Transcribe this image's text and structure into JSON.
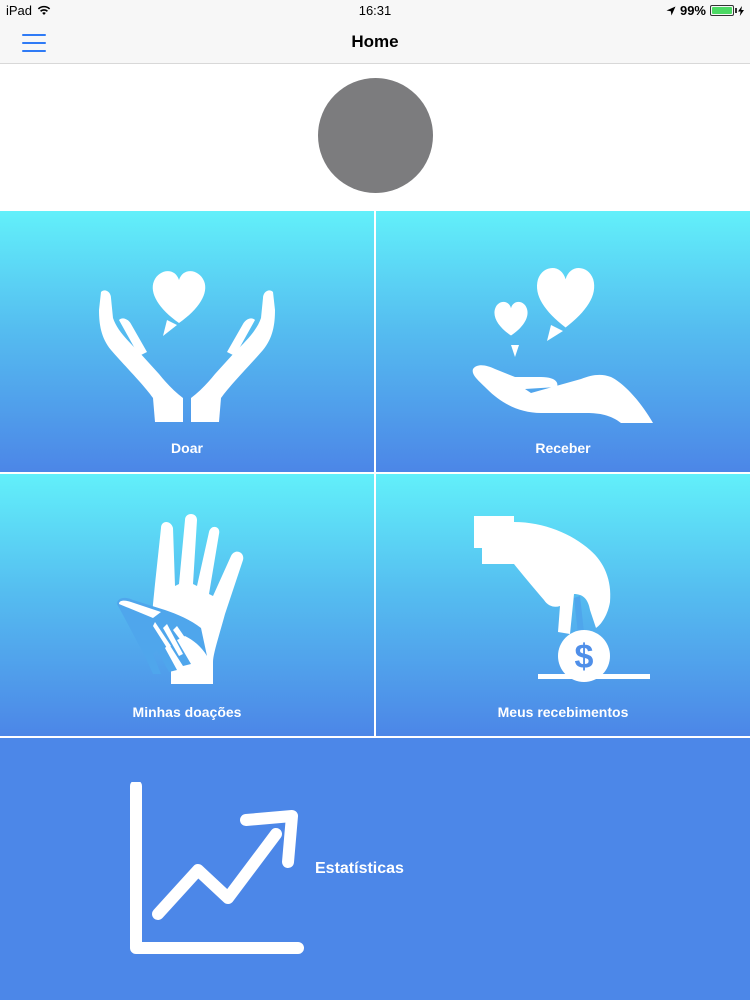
{
  "status_bar": {
    "device": "iPad",
    "time": "16:31",
    "battery": "99%",
    "battery_level": 0.99
  },
  "nav": {
    "title": "Home"
  },
  "tiles": {
    "doar": {
      "label": "Doar"
    },
    "receber": {
      "label": "Receber"
    },
    "minhas_doacoes": {
      "label": "Minhas doações"
    },
    "meus_recebimentos": {
      "label": "Meus recebimentos"
    },
    "estatisticas": {
      "label": "Estatísticas"
    }
  },
  "colors": {
    "accent": "#2f7bf6",
    "tile_top": "#62f0fa",
    "tile_bottom": "#4c86e7",
    "stats_bg": "#4c87e8",
    "avatar": "#7c7c7e"
  }
}
